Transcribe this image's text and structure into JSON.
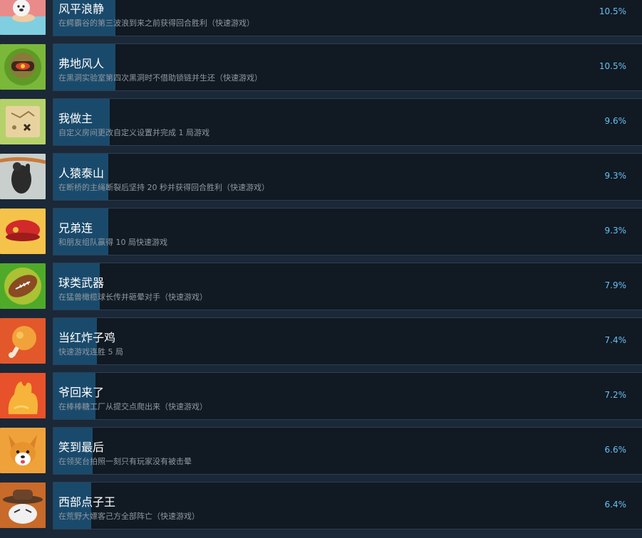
{
  "achievements": [
    {
      "title": "风平浪静",
      "desc": "在鳄霸谷的第三波浪到来之前获得回合胜利（快速游戏）",
      "percent": "10.5%",
      "percent_value": 10.5,
      "icon": "seal-icon"
    },
    {
      "title": "弗地风人",
      "desc": "在黑洞实验室第四次黑洞时不借助锁链并生还（快速游戏）",
      "percent": "10.5%",
      "percent_value": 10.5,
      "icon": "robot-icon"
    },
    {
      "title": "我做主",
      "desc": "自定义房间更改自定义设置并完成 1 局游戏",
      "percent": "9.6%",
      "percent_value": 9.6,
      "icon": "map-icon"
    },
    {
      "title": "人猿泰山",
      "desc": "在断桥的主绳断裂后坚持 20 秒并获得回合胜利（快速游戏）",
      "percent": "9.3%",
      "percent_value": 9.3,
      "icon": "gorilla-icon"
    },
    {
      "title": "兄弟连",
      "desc": "和朋友组队赢得 10 局快速游戏",
      "percent": "9.3%",
      "percent_value": 9.3,
      "icon": "beret-icon"
    },
    {
      "title": "球类武器",
      "desc": "在猛兽橄榄球长传并砸晕对手（快速游戏）",
      "percent": "7.9%",
      "percent_value": 7.9,
      "icon": "football-icon"
    },
    {
      "title": "当红炸子鸡",
      "desc": "快速游戏连胜 5 局",
      "percent": "7.4%",
      "percent_value": 7.4,
      "icon": "chicken-icon"
    },
    {
      "title": "爷回来了",
      "desc": "在棒棒糖工厂从提交点爬出来（快速游戏）",
      "percent": "7.2%",
      "percent_value": 7.2,
      "icon": "hand-icon"
    },
    {
      "title": "笑到最后",
      "desc": "在领奖台拍照一刻只有玩家没有被击晕",
      "percent": "6.6%",
      "percent_value": 6.6,
      "icon": "corgi-icon"
    },
    {
      "title": "西部点子王",
      "desc": "在荒野大嫖客己方全部阵亡（快速游戏）",
      "percent": "6.4%",
      "percent_value": 6.4,
      "icon": "cowboy-icon"
    }
  ],
  "colors": {
    "background": "#1b2838",
    "panel": "#111922",
    "progress_fill": "#1a4a6b",
    "percent_text": "#66c0f4"
  }
}
